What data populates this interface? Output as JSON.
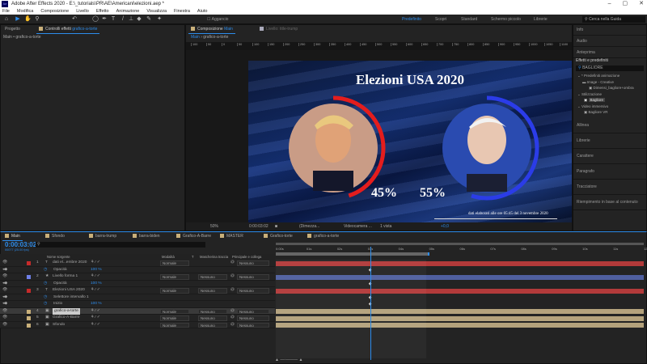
{
  "window": {
    "title": "Adobe After Effects 2020 - E:\\_tutorials\\PR\\AE\\Americani\\elezioni.aep *",
    "app_icon": "Ae"
  },
  "menu": [
    "File",
    "Modifica",
    "Composizione",
    "Livello",
    "Effetto",
    "Animazione",
    "Visualizza",
    "Finestra",
    "Aiuto"
  ],
  "toolbar": {
    "snap_label": "Aggancio",
    "workspaces": [
      "Predefinito",
      "Scopri",
      "Standard",
      "Schermo piccolo",
      "Librerie"
    ],
    "active_workspace": "Predefinito",
    "search_placeholder": "Cerca nella Guida"
  },
  "left_panel": {
    "tabs": [
      "Progetto",
      "Controlli effetti",
      "grafico-a-torte"
    ],
    "breadcrumb": "Main • grafico-a-torte"
  },
  "comp_panel": {
    "tab_label": "Composizione",
    "tab_comp": "Main",
    "layer_tab": "Livello: title-trump",
    "subtabs": [
      "Main",
      "grafico-a-torte"
    ],
    "ruler": [
      "100",
      "50",
      "0",
      "50",
      "100",
      "150",
      "200",
      "250",
      "300",
      "350",
      "400",
      "450",
      "500",
      "550",
      "600",
      "650",
      "700",
      "750",
      "800",
      "850",
      "900",
      "950",
      "1000",
      "1050",
      "1100"
    ],
    "title": "Elezioni USA 2020",
    "pct_left": "45%",
    "pct_right": "55%",
    "footer": "dati elaborati alle ore 05:45 del 3 novembre 2020",
    "controls": {
      "zoom": "50%",
      "time": "0:00:03:02",
      "resolution": "(Dimezza...",
      "camera": "Videocamera ...",
      "views": "1 vista",
      "exposure": "+0,0"
    },
    "colors": {
      "left_ring": "#e41d1d",
      "right_ring": "#2b3ce8"
    }
  },
  "right_panel": {
    "items_top": [
      "Info",
      "Audio",
      "Anteprima"
    ],
    "effects_title": "Effetti e predefiniti",
    "effects_search": "BAGLIORE",
    "tree": [
      "* Predefiniti animazione",
      "Image - Creative",
      "Dimensi_bagliore+ombra",
      "Stilizzazione",
      "Bagliore",
      "Video immersivo",
      "Bagliore VR"
    ],
    "items_bottom": [
      "Allinea",
      "Librerie",
      "Carattere",
      "Paragrafo",
      "Tracciatore",
      "Riempimento in base al contenuto"
    ]
  },
  "timeline": {
    "tabs": [
      "Main",
      "Sfondo",
      "barra-trump",
      "barra-biden",
      "Grafico-A-Barre",
      "MASTER",
      "Grafico-torte",
      "grafico-a-torte"
    ],
    "timecode": "0:00:03:02",
    "frames": "00077 (25.00 fps)",
    "search_placeholder": "",
    "headers": {
      "name": "Nome sorgente",
      "mode": "Modalità",
      "t": "T",
      "track": "Mascherina traccia",
      "parent": "Principale e collega"
    },
    "ruler": [
      "0:00s",
      "01s",
      "02s",
      "03s",
      "04s",
      "05s",
      "06s",
      "07s",
      "08s",
      "09s",
      "10s",
      "11s",
      "12s"
    ],
    "rows": [
      {
        "num": "1",
        "type": "T",
        "name": "dati el...embre 2020",
        "color": "#c72b2b",
        "mode": "Normale",
        "track": "",
        "parent": "Nessuno",
        "bar": "#b23a3a"
      },
      {
        "sub": true,
        "name": "Opacità",
        "value": "100 %"
      },
      {
        "num": "2",
        "type": "★",
        "name": "Livello forma 1",
        "color": "#6f80e8",
        "mode": "Normale",
        "track": "Nessuno",
        "parent": "Nessuno",
        "bar": "#4f5f9f"
      },
      {
        "sub": true,
        "name": "Opacità",
        "value": "100 %"
      },
      {
        "num": "3",
        "type": "T",
        "name": "Elezioni USA 2020",
        "color": "#c72b2b",
        "mode": "Normale",
        "track": "Nessuno",
        "parent": "Nessuno",
        "bar": "#b23a3a"
      },
      {
        "sub": true,
        "name": "Selettore intervallo 1",
        "value": ""
      },
      {
        "sub": true,
        "name": "Inizio",
        "value": "100 %"
      },
      {
        "num": "4",
        "type": "▣",
        "name": "grafico-a-torte",
        "color": "#c9b07a",
        "mode": "Normale",
        "track": "Nessuno",
        "parent": "Nessuno",
        "bar": "#b4a27c",
        "selected": true
      },
      {
        "num": "5",
        "type": "▣",
        "name": "Grafico-A-Barre",
        "color": "#c9b07a",
        "mode": "Normale",
        "track": "Nessuno",
        "parent": "Nessuno",
        "bar": "#b4a27c"
      },
      {
        "num": "6",
        "type": "▣",
        "name": "Sfondo",
        "color": "#c9b07a",
        "mode": "Normale",
        "track": "Nessuno",
        "parent": "Nessuno",
        "bar": "#b4a27c"
      }
    ],
    "playhead_seconds": 3.08,
    "duration_seconds": 12,
    "work_area_end_seconds": 5
  }
}
